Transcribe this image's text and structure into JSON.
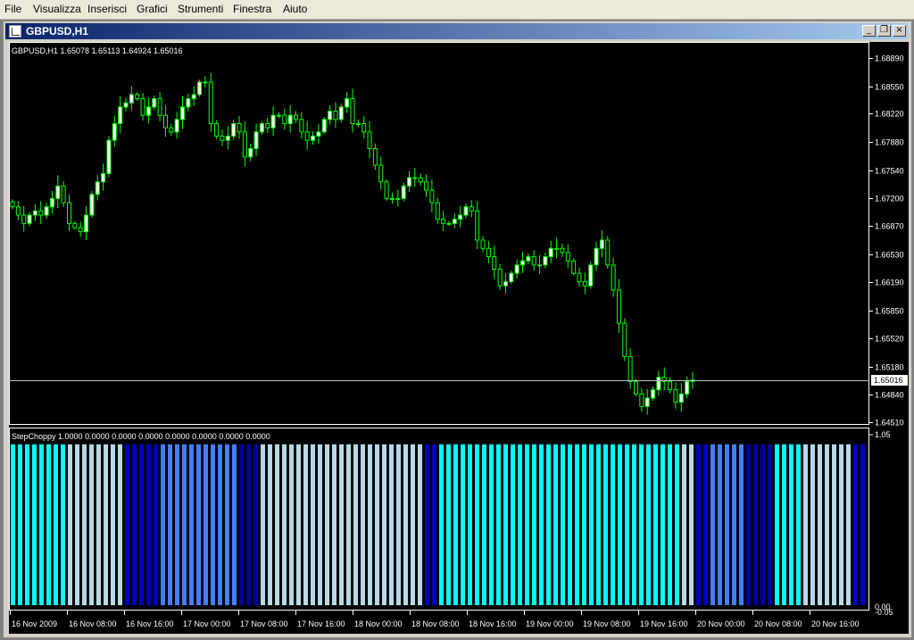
{
  "menu": {
    "items": [
      "File",
      "Visualizza",
      "Inserisci",
      "Grafici",
      "Strumenti",
      "Finestra",
      "Aiuto"
    ]
  },
  "window": {
    "title": "GBPUSD,H1",
    "minimize_glyph": "_",
    "restore_glyph": "❐",
    "close_glyph": "×"
  },
  "chart": {
    "header": "GBPUSD,H1  1.65078 1.65113 1.64924 1.65016",
    "price_ticks": [
      "1.68890",
      "1.68550",
      "1.68220",
      "1.67880",
      "1.67540",
      "1.67200",
      "1.66870",
      "1.66530",
      "1.66190",
      "1.65850",
      "1.65520",
      "1.65180",
      "1.64840",
      "1.64510"
    ],
    "current_price": "1.65016",
    "indicator_label": "StepChoppy 1.0000 0.0000 0.0000 0.0000 0.0000 0.0000 0.0000 0.0000",
    "indicator_ticks": [
      "1.05",
      "0.00",
      "-0.05"
    ],
    "time_labels": [
      "16 Nov 2009",
      "16 Nov 08:00",
      "16 Nov 16:00",
      "17 Nov 00:00",
      "17 Nov 08:00",
      "17 Nov 16:00",
      "18 Nov 00:00",
      "18 Nov 08:00",
      "18 Nov 16:00",
      "19 Nov 00:00",
      "19 Nov 08:00",
      "19 Nov 16:00",
      "20 Nov 00:00",
      "20 Nov 08:00",
      "20 Nov 16:00"
    ],
    "colors": {
      "background": "#000000",
      "bull_candle": "#ffffff",
      "bear_candle": "#000000",
      "wick": "#00ff00",
      "axis": "#ffffff",
      "price_line": "#c0c0c0"
    }
  },
  "chart_data": [
    {
      "type": "candlestick",
      "title": "GBPUSD,H1",
      "ylim": [
        1.6451,
        1.6905
      ],
      "close": [
        1.671,
        1.67,
        1.669,
        1.67,
        1.6705,
        1.67,
        1.671,
        1.672,
        1.6735,
        1.6715,
        1.669,
        1.6685,
        1.668,
        1.67,
        1.6725,
        1.674,
        1.675,
        1.679,
        1.681,
        1.683,
        1.6835,
        1.6845,
        1.684,
        1.682,
        1.683,
        1.684,
        1.682,
        1.6805,
        1.68,
        1.6815,
        1.683,
        1.684,
        1.6845,
        1.686,
        1.686,
        1.681,
        1.6795,
        1.679,
        1.6795,
        1.681,
        1.68,
        1.677,
        1.678,
        1.68,
        1.681,
        1.6805,
        1.682,
        1.682,
        1.681,
        1.682,
        1.6815,
        1.68,
        1.679,
        1.6795,
        1.68,
        1.6815,
        1.6825,
        1.6815,
        1.683,
        1.684,
        1.681,
        1.681,
        1.68,
        1.678,
        1.676,
        1.674,
        1.672,
        1.672,
        1.672,
        1.6735,
        1.6745,
        1.6745,
        1.674,
        1.673,
        1.6715,
        1.6695,
        1.669,
        1.669,
        1.6695,
        1.67,
        1.671,
        1.6705,
        1.667,
        1.666,
        1.665,
        1.6635,
        1.6615,
        1.662,
        1.663,
        1.664,
        1.6645,
        1.665,
        1.664,
        1.664,
        1.665,
        1.666,
        1.666,
        1.6655,
        1.6645,
        1.663,
        1.662,
        1.6615,
        1.664,
        1.666,
        1.667,
        1.664,
        1.661,
        1.657,
        1.653,
        1.65,
        1.6485,
        1.647,
        1.648,
        1.649,
        1.6505,
        1.65,
        1.649,
        1.6475,
        1.6485,
        1.65,
        1.65016
      ]
    },
    {
      "type": "bar",
      "title": "StepChoppy",
      "ylim": [
        -0.05,
        1.05
      ],
      "values": [
        1,
        1,
        1,
        1,
        1,
        1,
        1,
        1,
        1,
        1,
        1,
        1,
        1,
        1,
        1,
        1,
        1,
        1,
        1,
        1,
        1,
        1,
        1,
        1,
        1,
        1,
        1,
        1,
        1,
        1,
        1,
        1,
        1,
        1,
        1,
        1,
        1,
        1,
        1,
        1,
        1,
        1,
        1,
        1,
        1,
        1,
        1,
        1,
        1,
        1,
        1,
        1,
        1,
        1,
        1,
        1,
        1,
        1,
        1,
        1,
        1,
        1,
        1,
        1,
        1,
        1,
        1,
        1,
        1,
        1,
        1,
        1,
        1,
        1,
        1,
        1,
        1,
        1,
        1,
        1,
        1,
        1,
        1,
        1,
        1,
        1,
        1,
        1,
        1,
        1,
        1,
        1,
        1,
        1,
        1,
        1,
        1,
        1,
        1,
        1,
        1,
        1,
        1,
        1,
        1,
        1,
        1,
        1,
        1,
        1,
        1,
        1,
        1,
        1,
        1,
        1,
        1,
        1,
        1,
        1
      ],
      "color_groups": [
        {
          "count": 8,
          "color": "#00ffff"
        },
        {
          "count": 8,
          "color": "#b8d8e8"
        },
        {
          "count": 5,
          "color": "#0000c0"
        },
        {
          "count": 11,
          "color": "#4080ff"
        },
        {
          "count": 3,
          "color": "#0000a0"
        },
        {
          "count": 23,
          "color": "#b8d8e8"
        },
        {
          "count": 2,
          "color": "#0000c0"
        },
        {
          "count": 34,
          "color": "#00ffff"
        },
        {
          "count": 2,
          "color": "#b8d8e8"
        },
        {
          "count": 2,
          "color": "#0000c0"
        },
        {
          "count": 5,
          "color": "#4080ff"
        },
        {
          "count": 4,
          "color": "#0000a0"
        },
        {
          "count": 4,
          "color": "#00ffff"
        },
        {
          "count": 7,
          "color": "#b8d8e8"
        },
        {
          "count": 2,
          "color": "#0000c0"
        },
        {
          "count": 2,
          "color": "#4080ff"
        },
        {
          "count": 2,
          "color": "#0000a0"
        }
      ]
    }
  ]
}
